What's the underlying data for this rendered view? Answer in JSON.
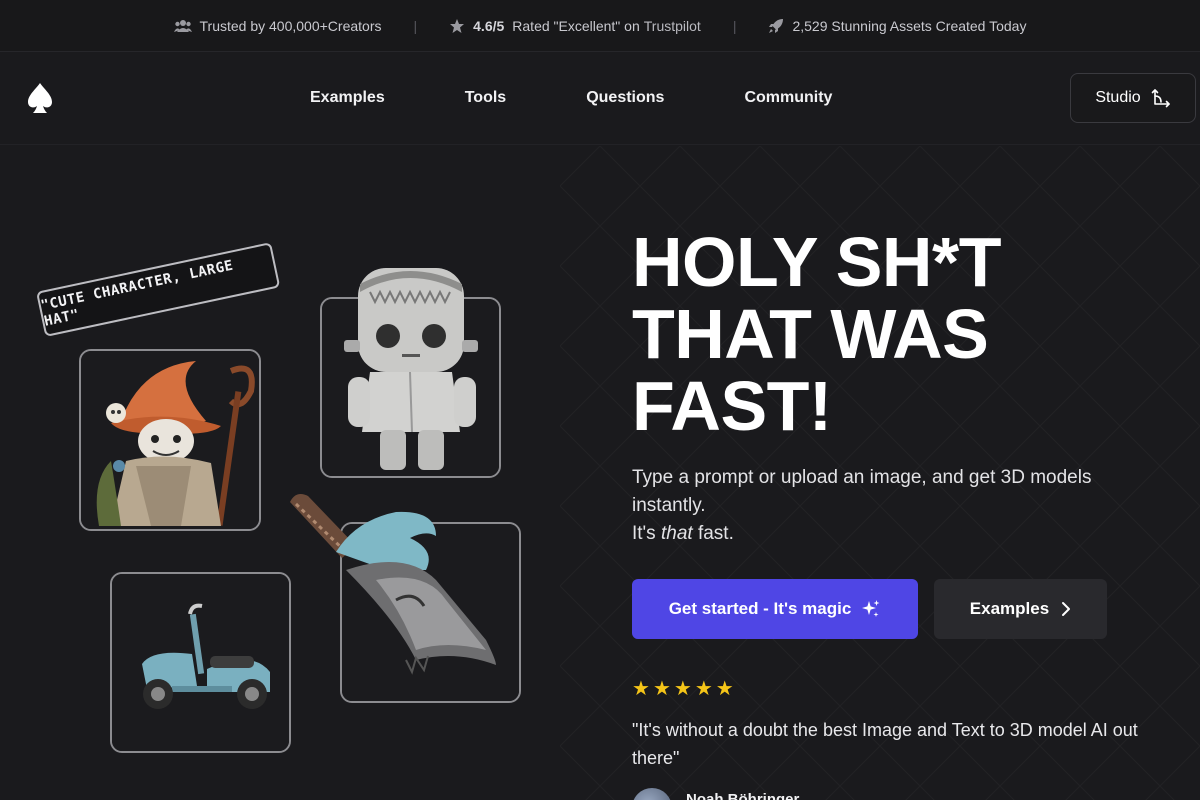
{
  "topbar": {
    "trusted": "Trusted by 400,000+Creators",
    "rating_score": "4.6/5",
    "rating_text": "Rated \"Excellent\" on",
    "rating_platform": "Trustpilot",
    "assets": "2,529 Stunning Assets Created Today",
    "separator": "|"
  },
  "nav": {
    "links": [
      "Examples",
      "Tools",
      "Questions",
      "Community"
    ],
    "studio_label": "Studio"
  },
  "hero": {
    "tag_label": "\"CUTE CHARACTER, LARGE HAT\"",
    "headline_line1": "HOLY SH*T",
    "headline_line2": "THAT WAS",
    "headline_line3": "FAST!",
    "sub_line1": "Type a prompt or upload an image, and get 3D models instantly.",
    "sub_line2_pre": "It's ",
    "sub_line2_em": "that",
    "sub_line2_post": " fast.",
    "cta_primary": "Get started - It's magic",
    "cta_secondary": "Examples",
    "stars": [
      "★",
      "★",
      "★",
      "★",
      "★"
    ],
    "quote": "\"It's without a doubt the best Image and Text to 3D model AI out there\"",
    "reviewer": "Noah Böhringer"
  },
  "colors": {
    "background": "#1a1a1d",
    "accent": "#4f46e5",
    "star": "#f5c518"
  },
  "icons": [
    "users-icon",
    "star-icon",
    "rocket-icon",
    "logo-icon",
    "studio-arrows-icon",
    "sparkle-icon",
    "chevron-right-icon"
  ]
}
